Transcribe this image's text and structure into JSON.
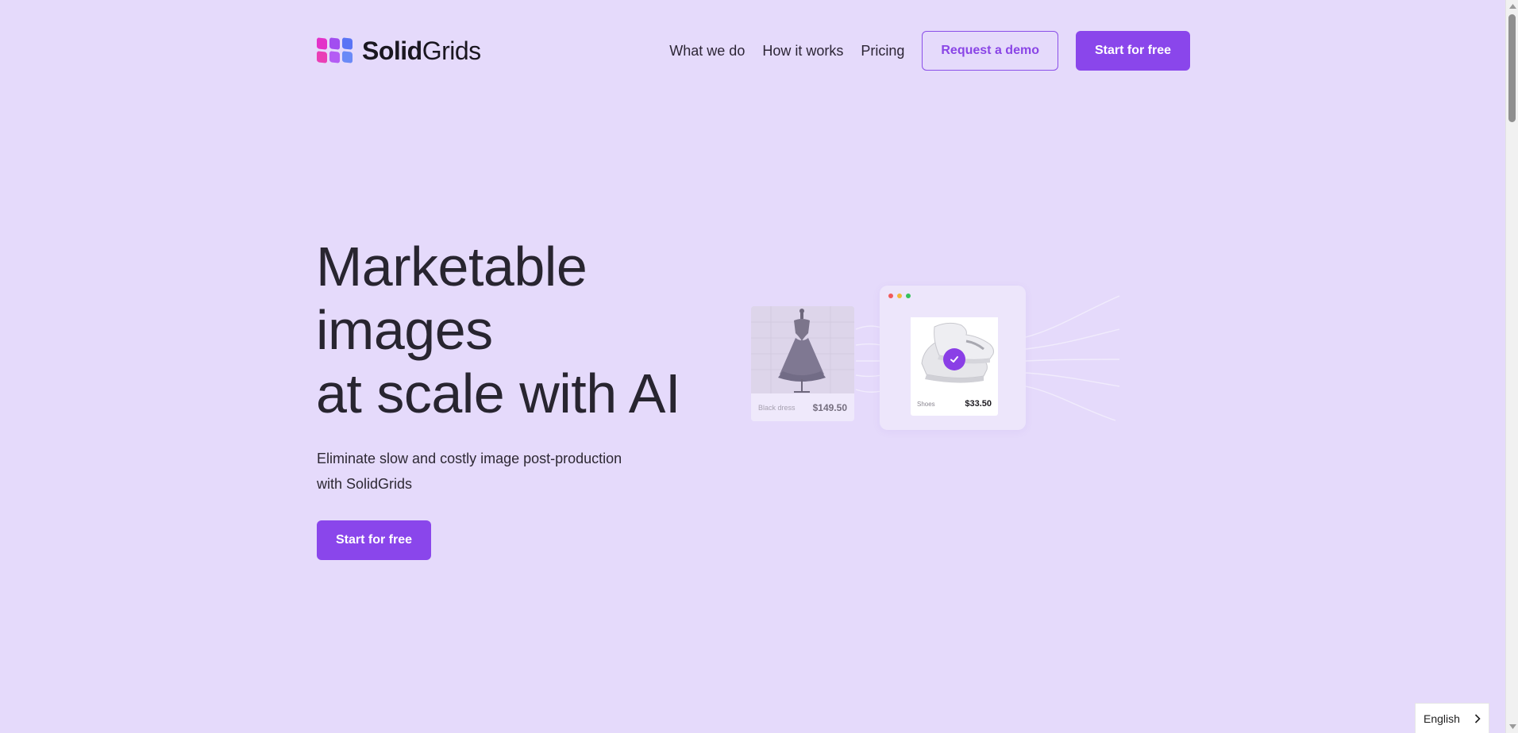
{
  "brand": {
    "bold": "Solid",
    "light": "Grids"
  },
  "nav": {
    "links": [
      "What we do",
      "How it works",
      "Pricing"
    ],
    "demo_button": "Request a demo",
    "start_button": "Start for free"
  },
  "hero": {
    "title_lines": [
      "Marketable",
      "images",
      "at scale with AI"
    ],
    "subtitle_line1": "Eliminate slow and costly image post-production",
    "subtitle_line2": "with SolidGrids",
    "cta": "Start for free"
  },
  "illustration": {
    "dress_card": {
      "name": "Black dress",
      "price": "$149.50"
    },
    "shoe_card": {
      "name": "Shoes",
      "price": "$33.50"
    }
  },
  "language": {
    "label": "English"
  },
  "colors": {
    "background": "#e5dafb",
    "accent": "#8a46eb",
    "logo": [
      "#e332c9",
      "#a24ef0",
      "#5a74f5"
    ]
  },
  "icons": [
    "logo-icon",
    "window-dots-icon",
    "check-icon",
    "chevron-right-icon",
    "scroll-arrow-icon"
  ]
}
